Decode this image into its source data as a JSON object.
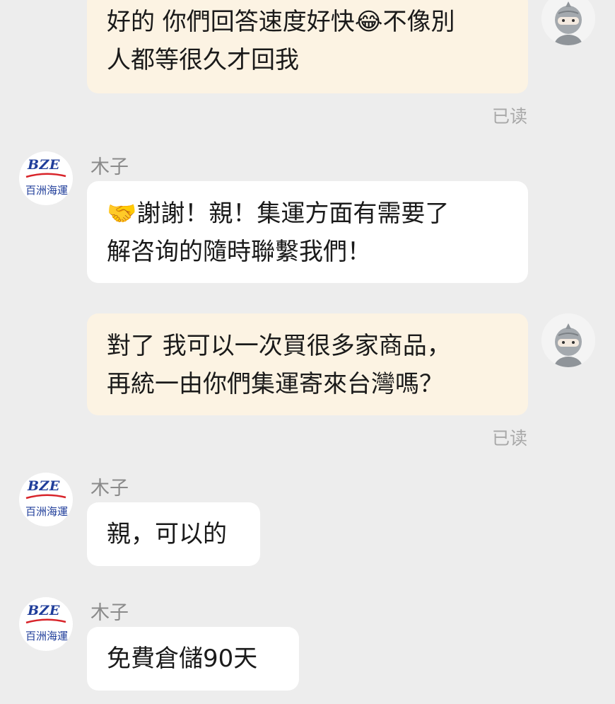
{
  "colors": {
    "background": "#ededed",
    "outgoing_bubble": "#fcf3e3",
    "incoming_bubble": "#ffffff",
    "read_receipt": "#a8a8a8",
    "sender_name": "#8a8a8a",
    "logo_blue": "#1f3d9a",
    "logo_red": "#d8242a"
  },
  "shop_logo": {
    "mark": "BZE",
    "name": "百洲海運"
  },
  "messages": [
    {
      "from": "user",
      "text": "好的 你們回答速度好快😂不像別\n人都等很久才回我",
      "status": "已读",
      "avatar_icon": "ninja-avatar-icon"
    },
    {
      "from": "shop",
      "sender": "木子",
      "text": "🤝謝謝！親！集運方面有需要了\n解咨询的隨時聯繫我們！"
    },
    {
      "from": "user",
      "text": "對了 我可以一次買很多家商品，\n再統一由你們集運寄來台灣嗎？",
      "status": "已读",
      "avatar_icon": "ninja-avatar-icon"
    },
    {
      "from": "shop",
      "sender": "木子",
      "text": "親，可以的"
    },
    {
      "from": "shop",
      "sender": "木子",
      "text": "免費倉儲90天"
    }
  ]
}
